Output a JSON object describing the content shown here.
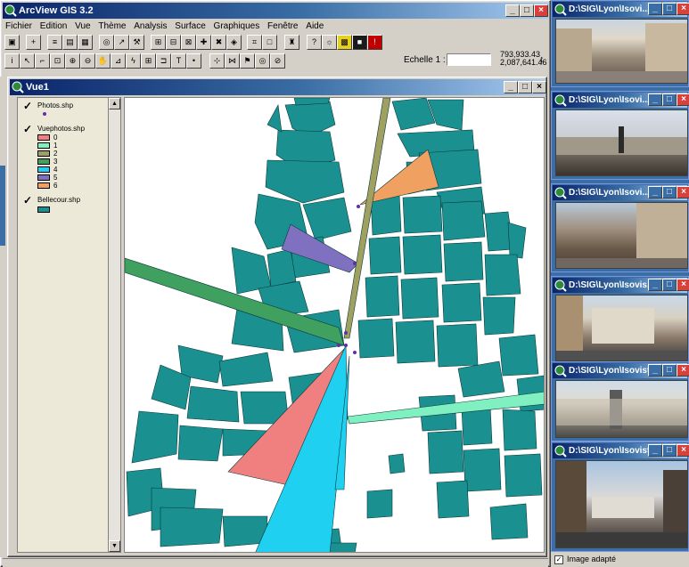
{
  "app": {
    "title": "ArcView GIS 3.2",
    "menu": [
      "Fichier",
      "Edition",
      "Vue",
      "Thème",
      "Analysis",
      "Surface",
      "Graphiques",
      "Fenêtre",
      "Aide"
    ],
    "scale_label": "Echelle 1 :",
    "scale_value": "",
    "coord_x": "793,933.43",
    "coord_y": "2,087,641.46"
  },
  "view": {
    "title": "Vue1",
    "legend": {
      "photos": {
        "label": "Photos.shp",
        "checked": "✓"
      },
      "vuephotos": {
        "label": "Vuephotos.shp",
        "checked": "✓",
        "classes": [
          {
            "label": "0",
            "color": "#f08080"
          },
          {
            "label": "1",
            "color": "#80f0c0"
          },
          {
            "label": "2",
            "color": "#a0a060"
          },
          {
            "label": "3",
            "color": "#40a060"
          },
          {
            "label": "4",
            "color": "#20d0f0"
          },
          {
            "label": "5",
            "color": "#8070c0"
          },
          {
            "label": "6",
            "color": "#f0a060"
          }
        ]
      },
      "bellecour": {
        "label": "Bellecour.shp",
        "checked": "✓",
        "color": "#1a9090"
      }
    }
  },
  "photos": [
    {
      "title": "D:\\SIG\\Lyon\\Isovi..."
    },
    {
      "title": "D:\\SIG\\Lyon\\Isovi..."
    },
    {
      "title": "D:\\SIG\\Lyon\\Isovi..."
    },
    {
      "title": "D:\\SIG\\Lyon\\Isovis..."
    },
    {
      "title": "D:\\SIG\\Lyon\\Isovist..."
    },
    {
      "title": "D:\\SIG\\Lyon\\Isovist..."
    }
  ],
  "image_adapt_label": "Image adapté",
  "colors": {
    "title_blue": "#0a246a",
    "block_teal": "#1a9090",
    "cone_red": "#f08080",
    "cone_cyan": "#20d0f0",
    "cone_orange": "#f0a060",
    "cone_purple": "#8070c0",
    "cone_green": "#40a060",
    "cone_mint": "#80f0c0",
    "cone_olive": "#a0a060"
  },
  "icons": [
    "arcview-globe-icon",
    "minimize-icon",
    "maximize-icon",
    "close-icon",
    "checkmark-icon",
    "scroll-up-icon",
    "scroll-down-icon"
  ]
}
